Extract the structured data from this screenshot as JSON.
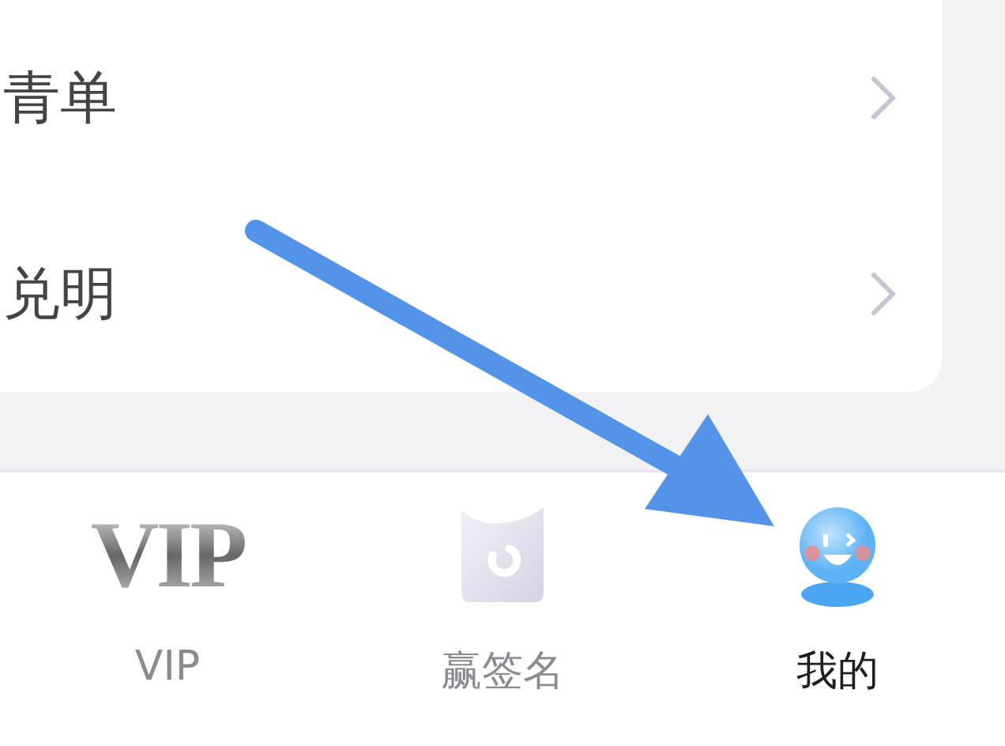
{
  "menu_items": [
    {
      "label": "青单"
    },
    {
      "label": "兑明"
    }
  ],
  "tab_bar": [
    {
      "label": "VIP",
      "kind": "vip",
      "logo_text": "VIP",
      "selected": false
    },
    {
      "label": "赢签名",
      "kind": "sign",
      "selected": false
    },
    {
      "label": "我的",
      "kind": "mine",
      "selected": true
    }
  ],
  "annotation": {
    "kind": "arrow"
  }
}
